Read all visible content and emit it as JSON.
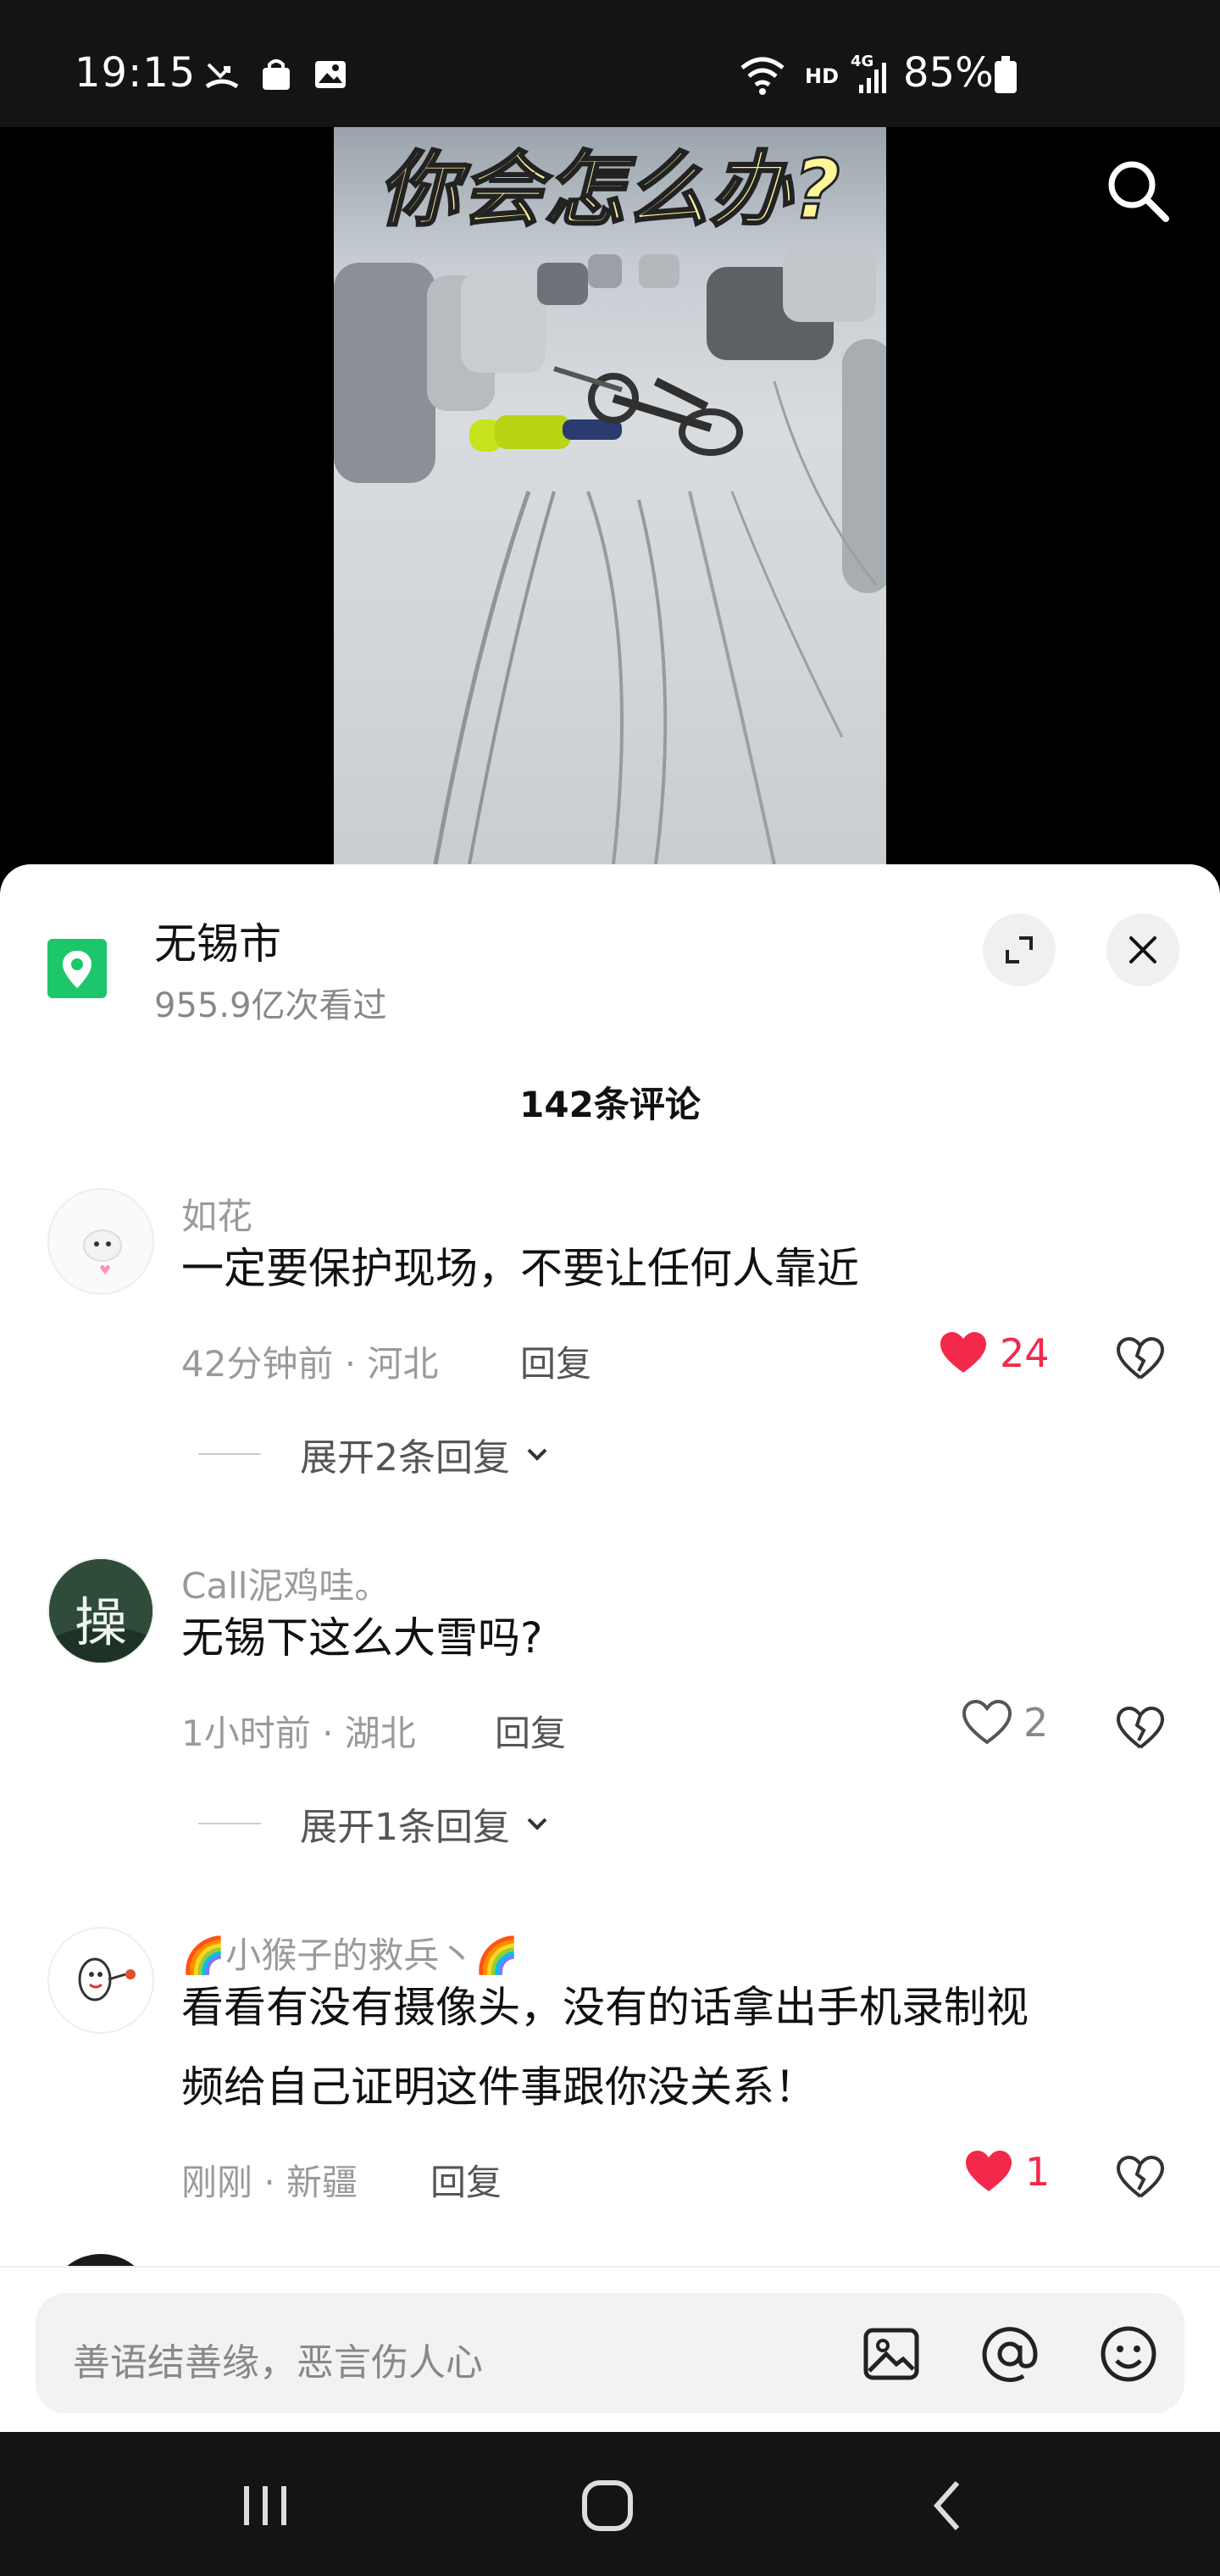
{
  "status_bar": {
    "time": "19:15",
    "network": "HD",
    "signal_label": "4G",
    "battery": "85%"
  },
  "video": {
    "caption": "你会怎么办?"
  },
  "sheet": {
    "location_title": "无锡市",
    "location_views": "955.9亿次看过",
    "comment_count": "142条评论"
  },
  "comments": [
    {
      "user": "如花",
      "text": "一定要保护现场，不要让任何人靠近",
      "meta": "42分钟前 · 河北",
      "reply_label": "回复",
      "likes": "24",
      "liked": true,
      "expand": "展开2条回复"
    },
    {
      "user": "Call泥鸡哇。",
      "text": "无锡下这么大雪吗?",
      "meta": "1小时前 · 湖北",
      "reply_label": "回复",
      "likes": "2",
      "liked": false,
      "expand": "展开1条回复",
      "avatar_char": "操"
    },
    {
      "user": "🌈小猴子的救兵丶🌈",
      "text_line1": "看看有没有摄像头，没有的话拿出手机录制视",
      "text_line2": "频给自己证明这件事跟你没关系！",
      "meta": "刚刚 · 新疆",
      "reply_label": "回复",
      "likes": "1",
      "liked": true
    }
  ],
  "input": {
    "placeholder": "善语结善缘，恶言伤人心"
  },
  "colors": {
    "like_red": "#f3294b",
    "location_green": "#1ec66b"
  }
}
